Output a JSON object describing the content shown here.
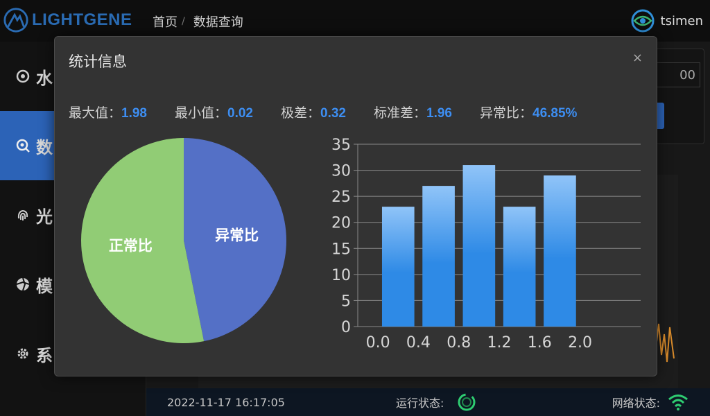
{
  "app": {
    "logo_text": "LIGHTGENE"
  },
  "breadcrumb": {
    "home": "首页",
    "separator": "/",
    "current": "数据查询"
  },
  "user": {
    "name": "tsimen"
  },
  "sidebar": {
    "items": [
      {
        "label": "水",
        "icon": "globe-icon"
      },
      {
        "label": "数",
        "icon": "search-data-icon",
        "active": true
      },
      {
        "label": "光",
        "icon": "fingerprint-icon"
      },
      {
        "label": "模",
        "icon": "aperture-icon"
      },
      {
        "label": "系",
        "icon": "gear-icon"
      }
    ]
  },
  "background": {
    "input_fragment": "00"
  },
  "modal": {
    "title": "统计信息",
    "close_glyph": "×",
    "stats": [
      {
        "label": "最大值：",
        "value": "1.98"
      },
      {
        "label": "最小值：",
        "value": "0.02"
      },
      {
        "label": "极差：",
        "value": "0.32"
      },
      {
        "label": "标准差：",
        "value": "1.96"
      },
      {
        "label": "异常比：",
        "value": "46.85%"
      }
    ]
  },
  "chart_data": [
    {
      "type": "pie",
      "slices": [
        {
          "name": "异常比",
          "value": 46.85,
          "color": "#5470c6"
        },
        {
          "name": "正常比",
          "value": 53.15,
          "color": "#91cc75"
        }
      ]
    },
    {
      "type": "bar",
      "x": [
        0.2,
        0.6,
        1.0,
        1.4,
        1.8
      ],
      "values": [
        23,
        27,
        31,
        23,
        29
      ],
      "xticks": [
        0.0,
        0.4,
        0.8,
        1.2,
        1.6,
        2.0
      ],
      "xlim": [
        -0.2,
        2.6
      ],
      "ylim": [
        0,
        35
      ],
      "yticks": [
        0,
        5,
        10,
        15,
        20,
        25,
        30,
        35
      ],
      "grid": true,
      "bar_color_top": "#90c4f8",
      "bar_color_bottom": "#2e8ae6"
    }
  ],
  "footer": {
    "datetime": "2022-11-17 16:17:05",
    "run_status_label": "运行状态:",
    "network_status_label": "网络状态:"
  },
  "colors": {
    "accent": "#2c63b7",
    "value_blue": "#3d8ef2",
    "status_green": "#2ecc71"
  }
}
